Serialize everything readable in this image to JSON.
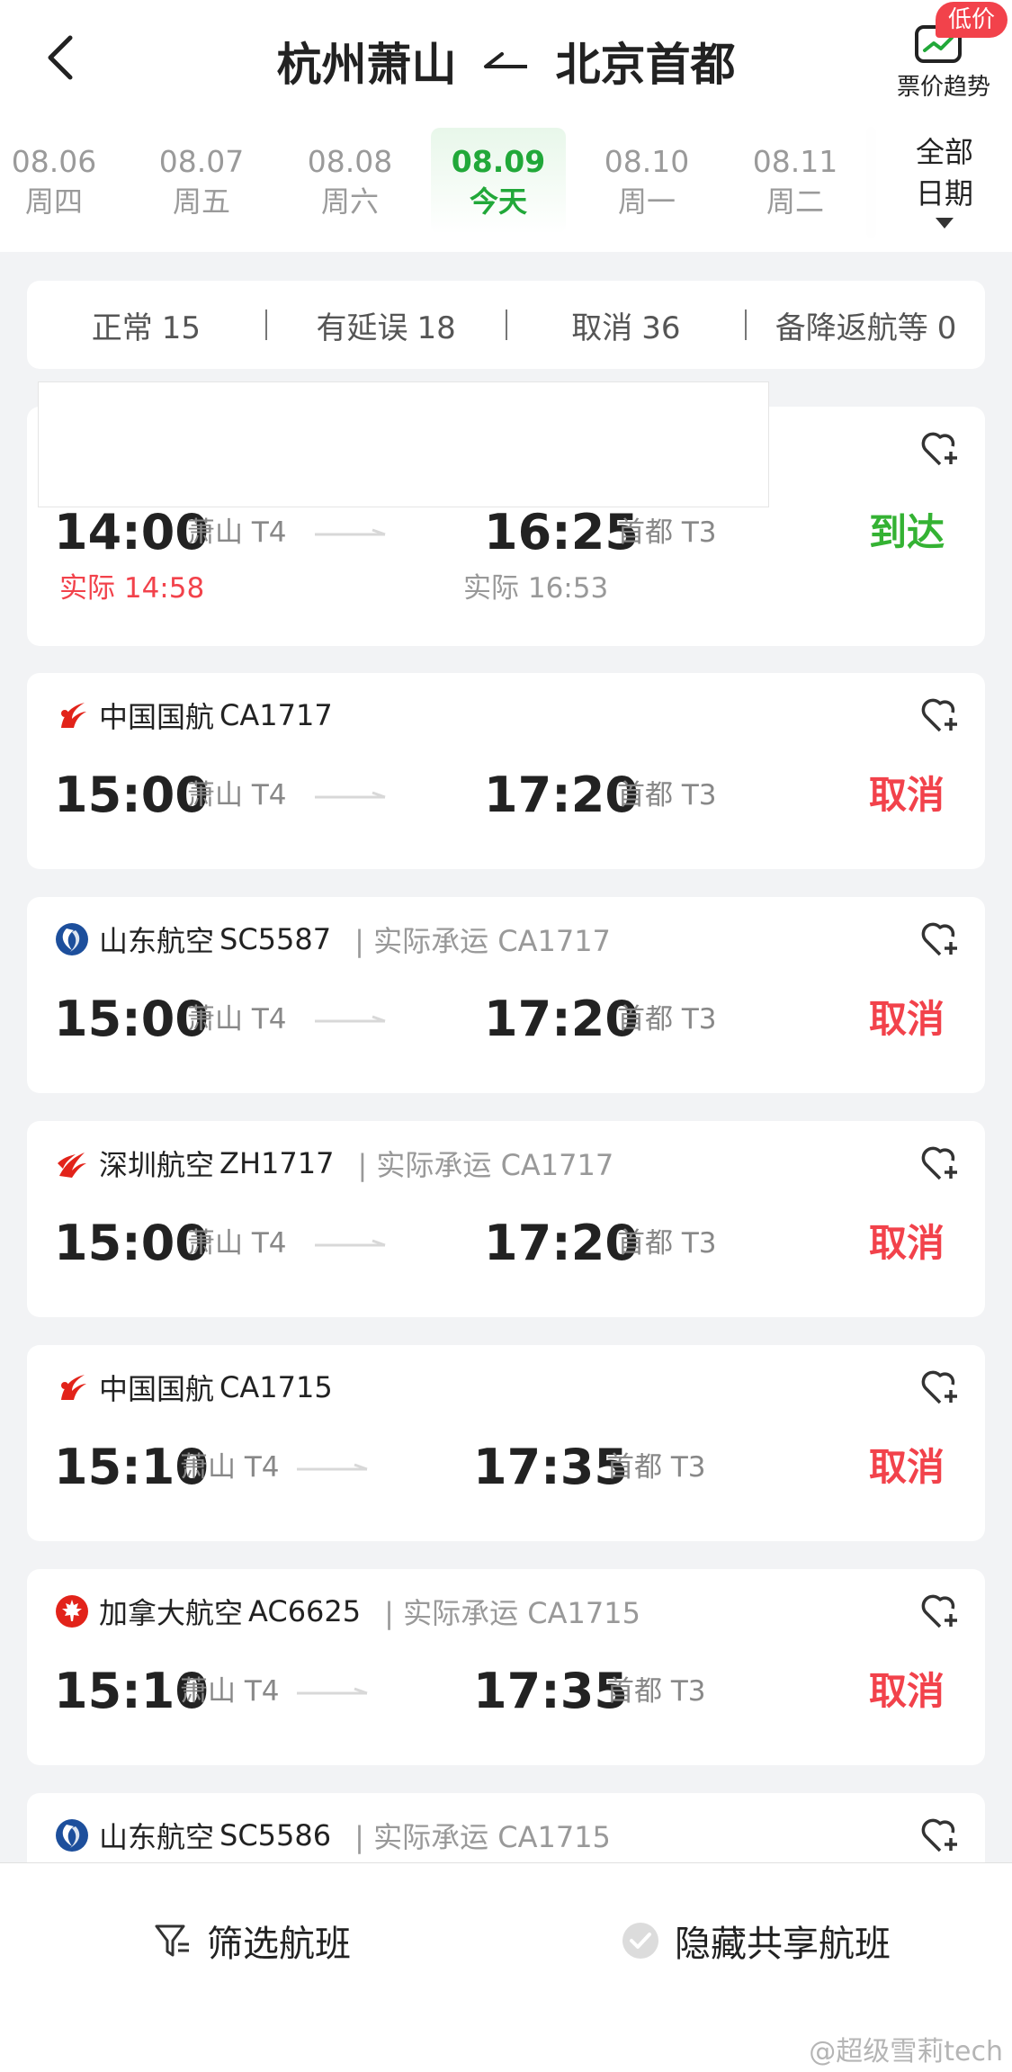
{
  "header": {
    "from": "杭州萧山",
    "to": "北京首都",
    "trend_badge": "低价",
    "trend_label": "票价趋势",
    "all_dates_line1": "全部",
    "all_dates_line2": "日期"
  },
  "dates": [
    {
      "date": "08.06",
      "weekday": "周四"
    },
    {
      "date": "08.07",
      "weekday": "周五"
    },
    {
      "date": "08.08",
      "weekday": "周六"
    },
    {
      "date": "08.09",
      "weekday": "今天"
    },
    {
      "date": "08.10",
      "weekday": "周一"
    },
    {
      "date": "08.11",
      "weekday": "周二"
    }
  ],
  "summary": [
    {
      "label": "正常",
      "count": "15"
    },
    {
      "label": "有延误",
      "count": "18"
    },
    {
      "label": "取消",
      "count": "36"
    },
    {
      "label": "备降返航等",
      "count": "0"
    }
  ],
  "flights": [
    {
      "airline": "",
      "flight_no": "",
      "codeshare": "",
      "logo": "",
      "dep_time": "14:00",
      "dep_terminal": "萧山 T4",
      "arr_time": "16:25",
      "arr_terminal": "首都 T3",
      "status": "到达",
      "actual_dep": "实际 14:58",
      "actual_arr": "实际 16:53"
    },
    {
      "airline": "中国国航",
      "flight_no": "CA1717",
      "codeshare": "",
      "logo": "air-china-logo-icon",
      "dep_time": "15:00",
      "dep_terminal": "萧山 T4",
      "arr_time": "17:20",
      "arr_terminal": "首都 T3",
      "status": "取消"
    },
    {
      "airline": "山东航空",
      "flight_no": "SC5587",
      "codeshare": "实际承运 CA1717",
      "logo": "shandong-airlines-logo-icon",
      "dep_time": "15:00",
      "dep_terminal": "萧山 T4",
      "arr_time": "17:20",
      "arr_terminal": "首都 T3",
      "status": "取消"
    },
    {
      "airline": "深圳航空",
      "flight_no": "ZH1717",
      "codeshare": "实际承运 CA1717",
      "logo": "shenzhen-airlines-logo-icon",
      "dep_time": "15:00",
      "dep_terminal": "萧山 T4",
      "arr_time": "17:20",
      "arr_terminal": "首都 T3",
      "status": "取消"
    },
    {
      "airline": "中国国航",
      "flight_no": "CA1715",
      "codeshare": "",
      "logo": "air-china-logo-icon",
      "dep_time": "15:10",
      "dep_terminal": "萧山 T4",
      "arr_time": "17:35",
      "arr_terminal": "首都 T3",
      "status": "取消"
    },
    {
      "airline": "加拿大航空",
      "flight_no": "AC6625",
      "codeshare": "实际承运 CA1715",
      "logo": "air-canada-logo-icon",
      "dep_time": "15:10",
      "dep_terminal": "萧山 T4",
      "arr_time": "17:35",
      "arr_terminal": "首都 T3",
      "status": "取消"
    },
    {
      "airline": "山东航空",
      "flight_no": "SC5586",
      "codeshare": "实际承运 CA1715",
      "logo": "shandong-airlines-logo-icon"
    }
  ],
  "bottom": {
    "filter_label": "筛选航班",
    "hide_shared_label": "隐藏共享航班"
  },
  "watermark": "@超级雪莉tech",
  "colors": {
    "accent_green": "#21a839",
    "arrived_green": "#34b233",
    "cancel_red": "#f2424b",
    "air_china_red": "#e2231a",
    "shandong_blue": "#1d4f9c"
  }
}
